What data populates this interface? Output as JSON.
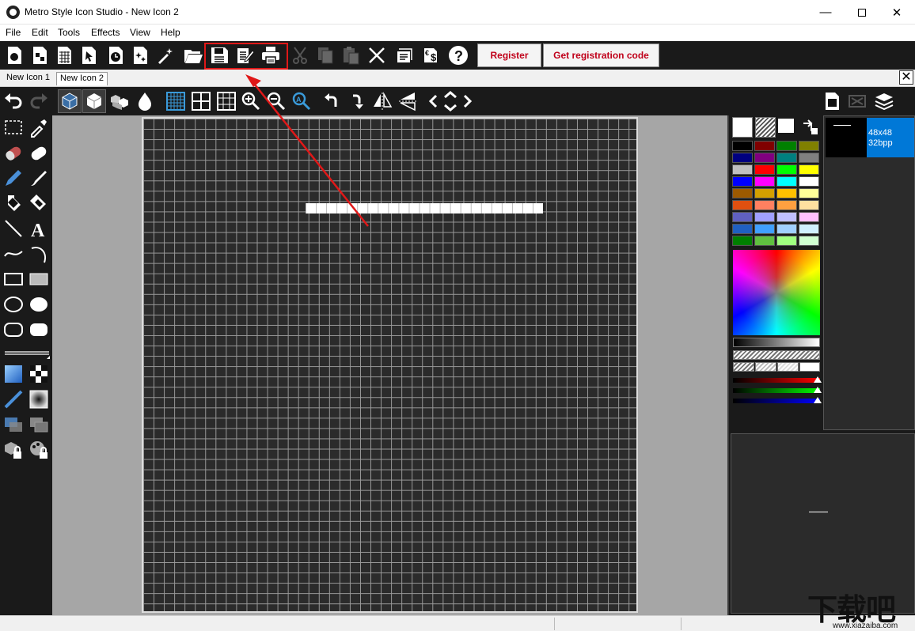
{
  "window": {
    "title": "Metro Style Icon Studio - New Icon 2",
    "minimize_glyph": "—",
    "close_glyph": "✕"
  },
  "menu": [
    "File",
    "Edit",
    "Tools",
    "Effects",
    "View",
    "Help"
  ],
  "toolbar": {
    "register_label": "Register",
    "get_code_label": "Get registration code"
  },
  "tabs": {
    "items": [
      "New Icon 1",
      "New Icon 2"
    ],
    "active": "New Icon 2",
    "close_glyph": "✕"
  },
  "format_list": {
    "items": [
      {
        "size": "48x48",
        "depth": "32bpp"
      }
    ]
  },
  "watermark": {
    "text": "下载吧",
    "url": "www.xiazaiba.com"
  },
  "colors": {
    "accent": "#0078d7",
    "highlight_red": "#e01818",
    "register_text": "#c0001a",
    "toolbar_bg": "#1a1a1a",
    "canvas_bg": "#2b2b2b"
  },
  "palette": [
    [
      "#000000",
      "#800000",
      "#008000",
      "#808000"
    ],
    [
      "#000080",
      "#800080",
      "#008080",
      "#808080"
    ],
    [
      "#c0c0c0",
      "#ff0000",
      "#00ff00",
      "#ffff00"
    ],
    [
      "#0000ff",
      "#ff00ff",
      "#00ffff",
      "#ffffff"
    ],
    [
      "#9c5a00",
      "#d4a000",
      "#ffc000",
      "#ffff99"
    ],
    [
      "#e05010",
      "#ff8060",
      "#ffa040",
      "#ffe0a0"
    ],
    [
      "#6060c0",
      "#a0a0ff",
      "#c0c0ff",
      "#ffc0ff"
    ],
    [
      "#2060c0",
      "#40a0ff",
      "#a0d0ff",
      "#d0f0ff"
    ],
    [
      "#008000",
      "#60c040",
      "#a0ff80",
      "#d0ffd0"
    ]
  ],
  "icons": {
    "main_toolbar": [
      "new-icon-icon",
      "new-from-image-icon",
      "new-grid-icon",
      "select-icon",
      "clock-icon",
      "sparkle-icon",
      "magic-wand-icon",
      "open-folder-icon",
      "save-icon",
      "save-as-icon",
      "print-icon",
      "cut-icon",
      "copy-icon",
      "paste-icon",
      "delete-icon",
      "certificate-icon",
      "price-icon",
      "help-icon"
    ],
    "secondary_toolbar": [
      "undo-icon",
      "redo-icon",
      "cube-dark-icon",
      "cube-light-icon",
      "cubes-icon",
      "drop-icon",
      "grid-fine-icon",
      "grid-coarse-icon",
      "grid-skew-icon",
      "zoom-in-icon",
      "zoom-out-icon",
      "zoom-fit-icon",
      "rotate-left-icon",
      "rotate-right-icon",
      "flip-horizontal-icon",
      "flip-vertical-icon",
      "move-icon",
      "page-icon",
      "filter-icon",
      "layers-icon"
    ],
    "left_tools": [
      "rect-select-icon",
      "eyedropper-icon",
      "eraser-icon",
      "eraser-light-icon",
      "pencil-icon",
      "brush-icon",
      "fill-icon",
      "fill-light-icon",
      "line-icon",
      "text-icon",
      "curve-icon",
      "arc-icon",
      "rectangle-outline-icon",
      "rectangle-filled-icon",
      "ellipse-outline-icon",
      "ellipse-filled-icon",
      "rounded-rect-outline-icon",
      "rounded-rect-filled-icon",
      "line-width-icon",
      "gradient-icon",
      "checker-icon",
      "stroke-icon",
      "fill-gradient-icon",
      "layer-copy-icon",
      "layer-merge-icon",
      "lock-icon",
      "palette-lock-icon"
    ]
  }
}
